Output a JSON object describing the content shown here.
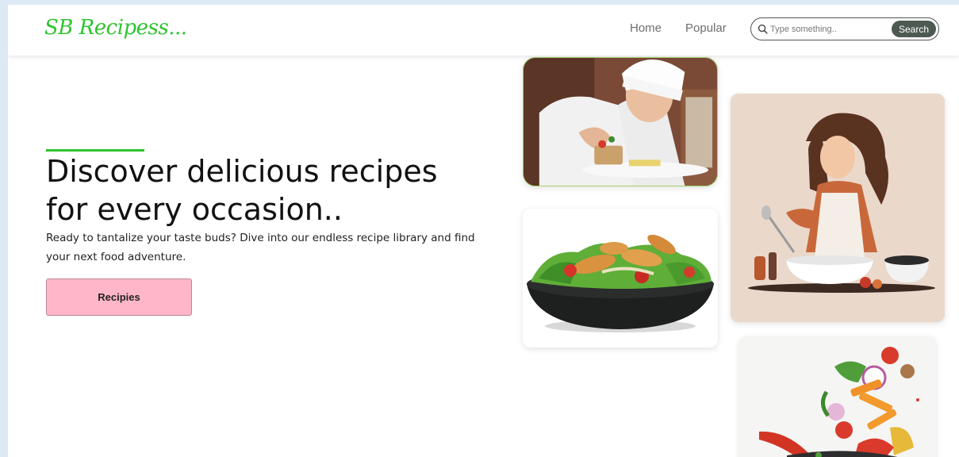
{
  "navbar": {
    "logo": "SB Recipess...",
    "links": [
      {
        "label": "Home"
      },
      {
        "label": "Popular"
      }
    ],
    "search": {
      "placeholder": "Type something..",
      "button_label": "Search"
    }
  },
  "hero": {
    "title_line1": "Discover delicious recipes",
    "title_line2": "for every occasion..",
    "subtitle": "Ready to tantalize your taste buds? Dive into our endless recipe library and find your next food adventure.",
    "button_label": "Recipies"
  },
  "colors": {
    "brand": "#2ec42e",
    "cta": "#ffb6c8",
    "search_button": "#4d5a52"
  },
  "images": [
    {
      "icon": "chef-plating-photo"
    },
    {
      "icon": "chicken-salad-bowl-photo"
    },
    {
      "icon": "woman-cooking-illustration"
    },
    {
      "icon": "flying-vegetables-pan-illustration"
    }
  ]
}
